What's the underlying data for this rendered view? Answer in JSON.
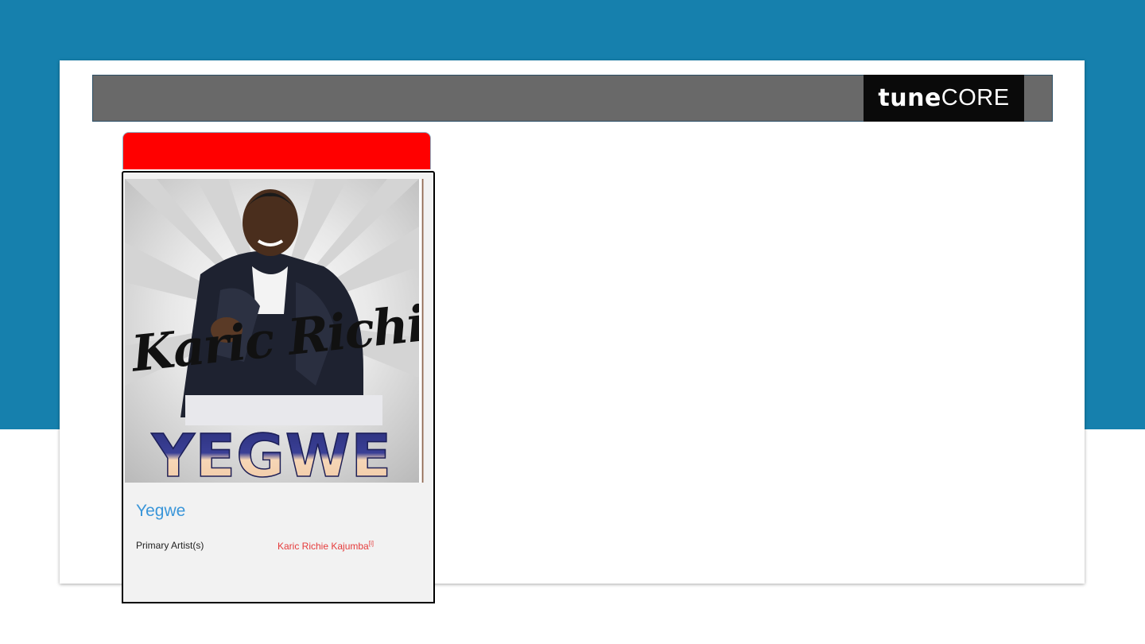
{
  "brand": {
    "logo_bold": "tune",
    "logo_light": "CORE"
  },
  "colors": {
    "background_band": "#1680ad",
    "header_bar": "#696969",
    "tab_accent": "#ff0000",
    "title_link": "#3a96d9",
    "artist_link": "#e53b3b"
  },
  "release": {
    "cover": {
      "artist_script": "Karic Richie",
      "title_text": "YEGWE"
    },
    "title": "Yegwe",
    "primary_artist_label": "Primary Artist(s)",
    "primary_artist_value": "Karic Richie Kajumba",
    "primary_artist_note": "[i]"
  }
}
